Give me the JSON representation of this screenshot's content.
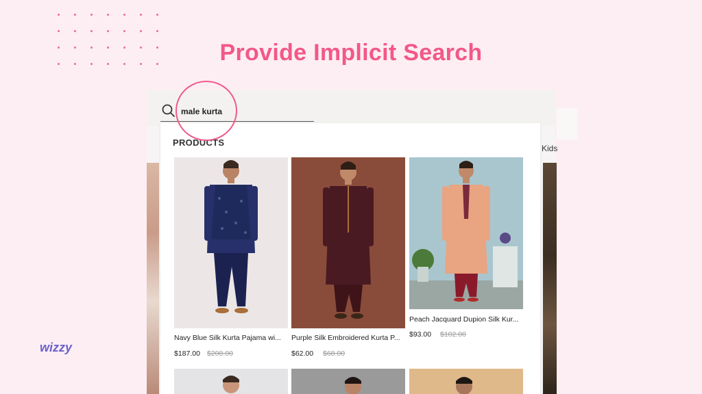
{
  "headline": "Provide Implicit Search",
  "brand": "wizzy",
  "search": {
    "query": "male kurta"
  },
  "site": {
    "nav_partial": "Kids"
  },
  "dropdown": {
    "section_title": "PRODUCTS",
    "products": [
      {
        "name": "Navy Blue Silk Kurta Pajama wi...",
        "price": "$187.00",
        "old_price": "$208.00"
      },
      {
        "name": "Purple Silk Embroidered Kurta P...",
        "price": "$62.00",
        "old_price": "$68.00"
      },
      {
        "name": "Peach Jacquard Dupion Silk Kur...",
        "price": "$93.00",
        "old_price": "$102.00"
      }
    ]
  },
  "colors": {
    "accent": "#f25888",
    "brand": "#6b63c9",
    "background": "#fdeef3"
  }
}
